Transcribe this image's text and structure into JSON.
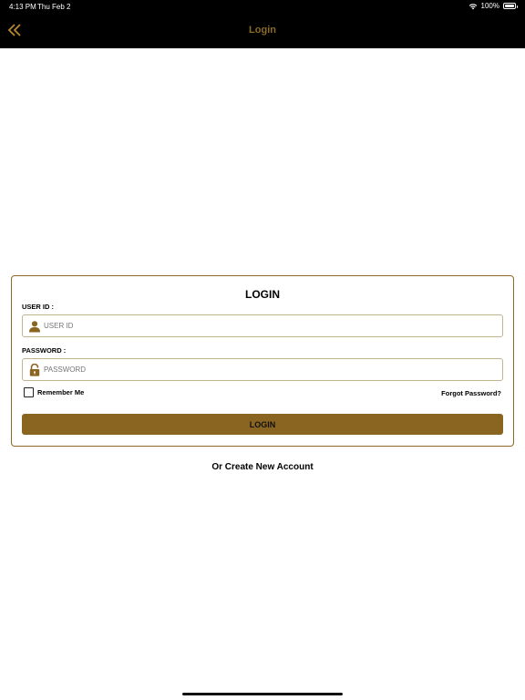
{
  "status_bar": {
    "time": "4:13 PM",
    "date": "Thu Feb 2",
    "battery": "100%",
    "icons": [
      "wifi-icon",
      "battery-icon"
    ]
  },
  "nav": {
    "title": "Login",
    "back_icon": "double-chevron-left-icon"
  },
  "login_form": {
    "title": "LOGIN",
    "user_id": {
      "label": "USER ID :",
      "placeholder": "USER ID",
      "value": "",
      "icon": "user-icon"
    },
    "password": {
      "label": "PASSWORD :",
      "placeholder": "PASSWORD",
      "value": "",
      "icon": "lock-icon"
    },
    "remember_me": {
      "label": "Remember Me",
      "checked": false
    },
    "forgot_password": "Forgot Password?",
    "submit_label": "LOGIN"
  },
  "create_account": "Or Create New Account",
  "colors": {
    "accent": "#8a6a24",
    "button": "#8a6522",
    "topbar": "#000000",
    "background": "#ffffff"
  }
}
